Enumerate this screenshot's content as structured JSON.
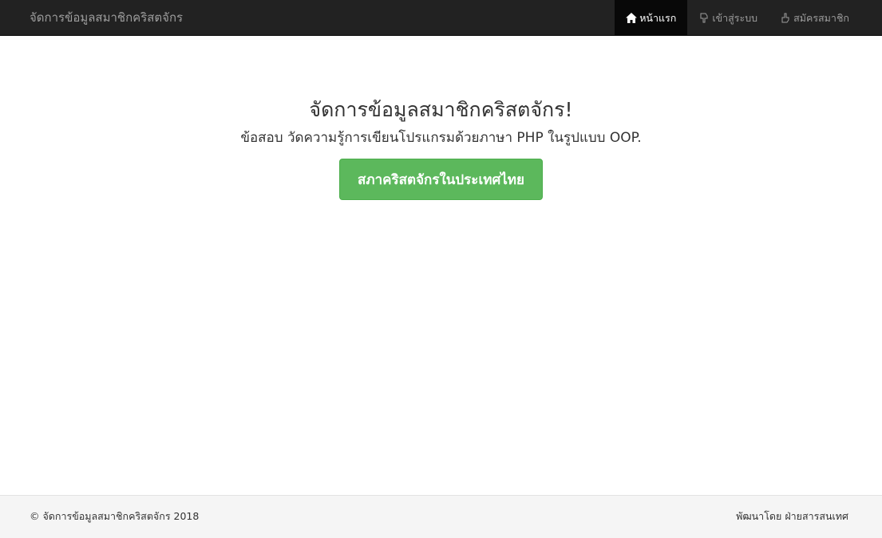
{
  "navbar": {
    "brand": "จัดการข้อมูลสมาชิกคริสตจักร",
    "items": [
      {
        "label": "หน้าแรก",
        "icon": "home-icon",
        "active": true
      },
      {
        "label": "เข้าสู่ระบบ",
        "icon": "hand-down-icon",
        "active": false
      },
      {
        "label": "สมัครสมาชิก",
        "icon": "hand-up-icon",
        "active": false
      }
    ]
  },
  "hero": {
    "title": "จัดการข้อมูลสมาชิกคริสตจักร!",
    "subtitle": "ข้อสอบ วัดความรู้การเขียนโปรแกรมด้วยภาษา PHP ในรูปแบบ OOP.",
    "button_label": "สภาคริสตจักรในประเทศไทย"
  },
  "footer": {
    "copyright": "© จัดการข้อมูลสมาชิกคริสตจักร 2018",
    "developer": "พัฒนาโดย ฝ่ายสารสนเทศ"
  },
  "colors": {
    "navbar_bg": "#222222",
    "active_bg": "#080808",
    "button_bg": "#5cb85c",
    "footer_bg": "#f5f5f5"
  }
}
